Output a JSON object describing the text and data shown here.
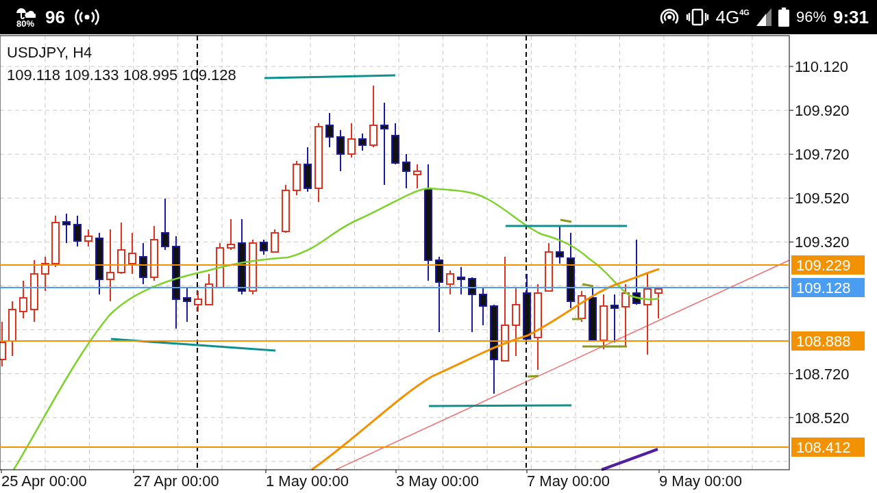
{
  "status_bar": {
    "weather_reading": "80%",
    "notification_count": "96",
    "network_type": "4G",
    "network_badge": "4G",
    "battery_percent": "96%",
    "time": "9:31"
  },
  "chart": {
    "symbol": "USDJPY, H4",
    "ohlc": "109.118 109.133 108.995 109.128",
    "price_ticks": [
      "110.120",
      "109.920",
      "109.720",
      "109.520",
      "109.320",
      "108.720",
      "108.520"
    ],
    "price_labels": [
      {
        "text": "109.229",
        "color": "#f39200"
      },
      {
        "text": "109.128",
        "color": "#4a9df0"
      },
      {
        "text": "108.888",
        "color": "#f39200"
      },
      {
        "text": "108.412",
        "color": "#f39200"
      }
    ],
    "time_ticks": [
      "25 Apr 00:00",
      "27 Apr 00:00",
      "1 May 00:00",
      "3 May 00:00",
      "7 May 00:00",
      "9 May 00:00"
    ]
  }
}
